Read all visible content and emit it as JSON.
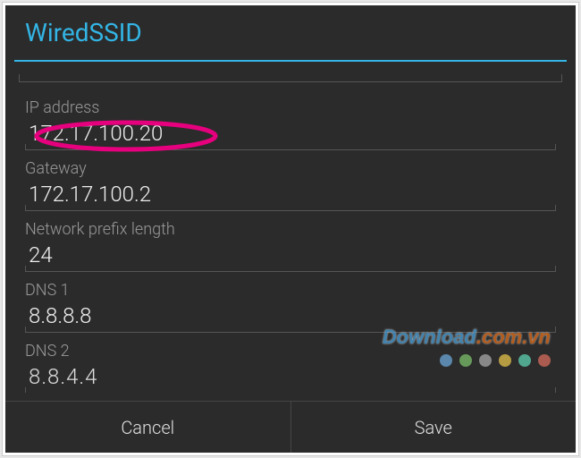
{
  "header": {
    "title": "WiredSSID"
  },
  "fields": {
    "ip": {
      "label": "IP address",
      "value": "172.17.100.20"
    },
    "gateway": {
      "label": "Gateway",
      "value": "172.17.100.2"
    },
    "prefix": {
      "label": "Network prefix length",
      "value": "24"
    },
    "dns1": {
      "label": "DNS 1",
      "value": "8.8.8.8"
    },
    "dns2": {
      "label": "DNS 2",
      "value": "8.8.4.4"
    }
  },
  "actions": {
    "cancel": "Cancel",
    "save": "Save"
  },
  "watermark": {
    "text_main": "Download",
    "text_suffix": ".com.vn"
  },
  "colors": {
    "accent": "#33b5e5",
    "dots": [
      "#6aa6d6",
      "#7bbf6a",
      "#a7a7a7",
      "#e3c24a",
      "#5ecfb1",
      "#d66b5b"
    ]
  }
}
